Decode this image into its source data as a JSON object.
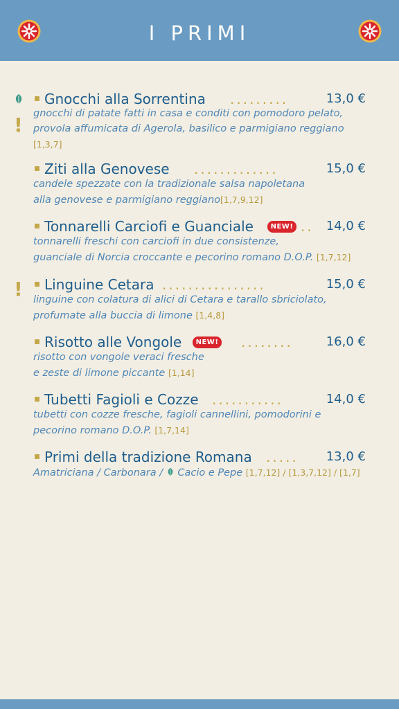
{
  "header": {
    "title": "I PRIMI"
  },
  "items": [
    {
      "name": "Gnocchi alla Sorrentina",
      "price": "13,0 €",
      "desc1": "gnocchi di patate fatti in casa e conditi con pomodoro pelato,",
      "desc2": "provola affumicata di Agerola, basilico e parmigiano reggiano",
      "allergens": "[1,3,7]",
      "vegetarian": true,
      "warning": true
    },
    {
      "name": "Ziti alla Genovese",
      "price": "15,0 €",
      "desc1": "candele spezzate con la tradizionale salsa napoletana",
      "desc2": "alla genovese e parmigiano reggiano",
      "allergens": "[1,7,9,12]"
    },
    {
      "name": "Tonnarelli Carciofi e Guanciale",
      "badge": "NEW!",
      "price": "14,0 €",
      "desc1": "tonnarelli freschi con carciofi in due consistenze,",
      "desc2": "guanciale di Norcia croccante e pecorino romano D.O.P.",
      "allergens": "[1,7,12]"
    },
    {
      "name": "Linguine Cetara",
      "price": "15,0 €",
      "desc1": "linguine con colatura di alici di Cetara e tarallo sbriciolato,",
      "desc2": "profumate alla buccia di limone",
      "allergens": "[1,4,8]",
      "warning": true
    },
    {
      "name": "Risotto alle Vongole",
      "badge": "NEW!",
      "price": "16,0 €",
      "desc1": "risotto con vongole veraci fresche",
      "desc2": "e zeste di limone piccante",
      "allergens": "[1,14]"
    },
    {
      "name": "Tubetti Fagioli e Cozze",
      "price": "14,0 €",
      "desc1": "tubetti con cozze fresche, fagioli cannellini, pomodorini e",
      "desc2": "pecorino romano D.O.P.",
      "allergens": "[1,7,14]"
    },
    {
      "name": "Primi della tradizione Romana",
      "price": "13,0 €",
      "desc1": "Amatriciana / Carbonara / ",
      "desc1b": "Cacio e Pepe",
      "allergens": "[1,7,12] / [1,3,7,12] / [1,7]"
    }
  ],
  "icons": {
    "logo": "pizza-wheel-logo",
    "leaf": "leaf-icon",
    "warning": "exclamation-icon"
  },
  "colors": {
    "header": "#6a9bc3",
    "background": "#f2eee3",
    "name": "#1f5d8c",
    "desc": "#4f86b6",
    "accent": "#c4a84a",
    "badge": "#d9252c"
  }
}
